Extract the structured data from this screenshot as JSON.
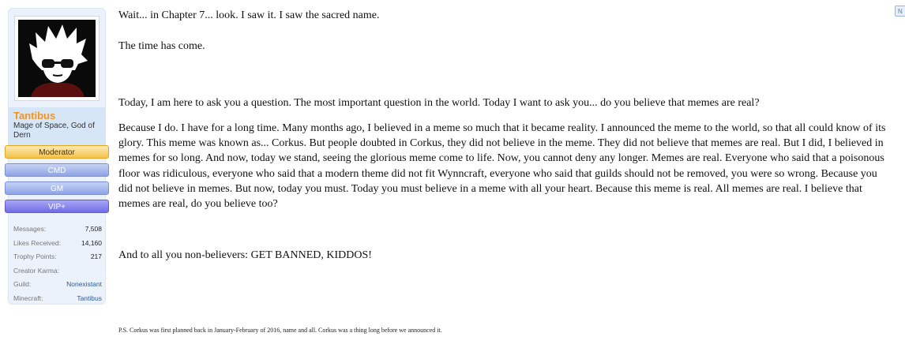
{
  "user": {
    "name": "Tantibus",
    "title": "Mage of Space, God of Dern",
    "banners": [
      "Moderator",
      "CMD",
      "GM",
      "VIP+"
    ],
    "stats": [
      {
        "label": "Messages:",
        "value": "7,508"
      },
      {
        "label": "Likes Received:",
        "value": "14,160"
      },
      {
        "label": "Trophy Points:",
        "value": "217"
      },
      {
        "label": "Creator Karma:",
        "value": ""
      },
      {
        "label": "Guild:",
        "value": "Nonexistant"
      },
      {
        "label": "Minecraft:",
        "value": "Tantibus"
      }
    ]
  },
  "badge": "N",
  "message": {
    "p1": "Wait... in Chapter 7... look. I saw it. I saw the sacred name.",
    "p2": "The time has come.",
    "p3": "Today, I am here to ask you a question. The most important question in the world. Today I want to ask you... do you believe that memes are real?",
    "p4": "Because I do. I have for a long time. Many months ago, I believed in a meme so much that it became reality. I announced the meme to the world, so that all could know of its glory. This meme was known as... Corkus. But people doubted in Corkus, they did not believe in the meme. They did not believe that memes are real. But I did, I believed in memes for so long. And now, today we stand, seeing the glorious meme come to life. Now, you cannot deny any longer. Memes are real. Everyone who said that a poisonous floor was ridiculous, everyone who said that a modern theme did not fit Wynncraft, everyone who said that guilds should not be removed, you were so wrong. Because you did not believe in memes. But now, today you must. Today you must believe in a meme with all your heart. Because this meme is real. All memes are real. I believe that memes are real, do you believe too?",
    "p5": "And to all you non-believers: GET BANNED, KIDDOS!"
  },
  "signature": "P.S. Corkus was first planned back in January-February of 2016, name and all. Corkus was a thing long before we announced it."
}
